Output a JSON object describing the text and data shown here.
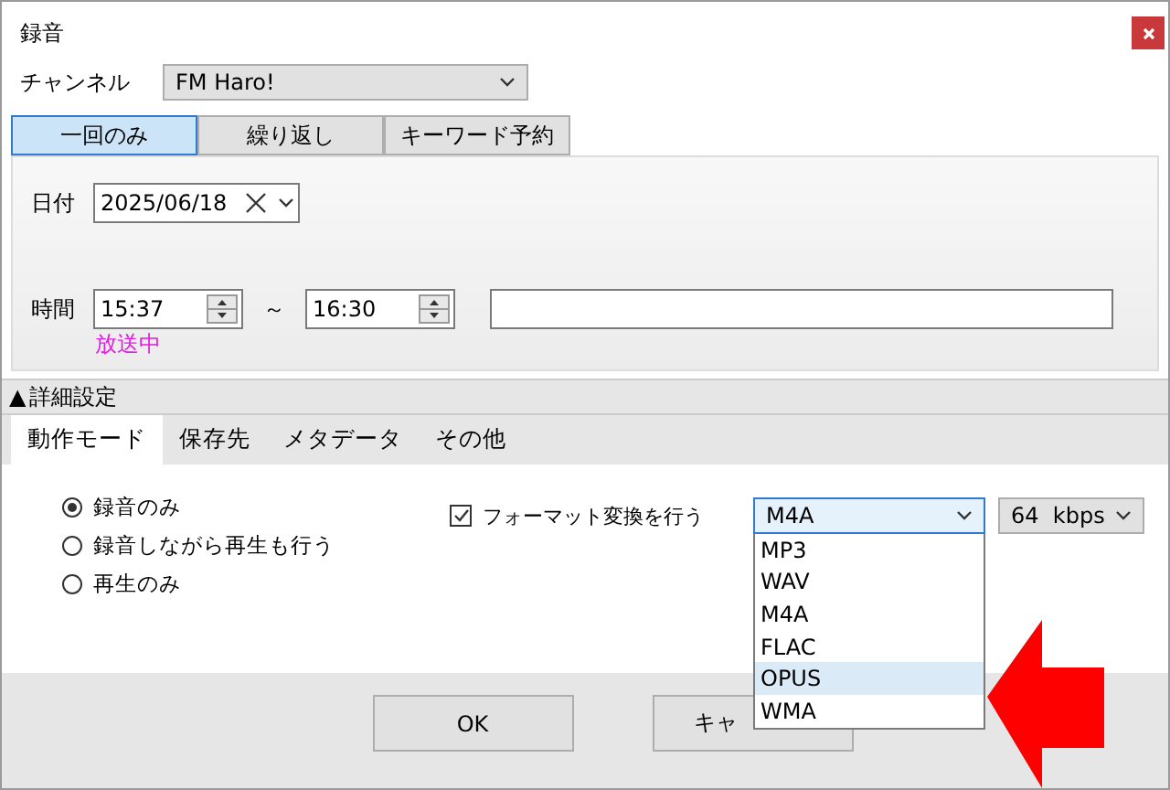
{
  "window": {
    "title": "録音"
  },
  "channel": {
    "label": "チャンネル",
    "value": "FM Haro!"
  },
  "schedule_tabs": [
    {
      "label": "一回のみ",
      "selected": true
    },
    {
      "label": "繰り返し",
      "selected": false
    },
    {
      "label": "キーワード予約",
      "selected": false
    }
  ],
  "date": {
    "label": "日付",
    "value": "2025/06/18"
  },
  "time": {
    "label": "時間",
    "start": "15:37",
    "separator": "～",
    "end": "16:30",
    "status": "放送中"
  },
  "details": {
    "toggle": "▲",
    "label": "詳細設定"
  },
  "settings_tabs": [
    {
      "label": "動作モード",
      "selected": true
    },
    {
      "label": "保存先",
      "selected": false
    },
    {
      "label": "メタデータ",
      "selected": false
    },
    {
      "label": "その他",
      "selected": false
    }
  ],
  "modes": [
    {
      "label": "録音のみ",
      "selected": true
    },
    {
      "label": "録音しながら再生も行う",
      "selected": false
    },
    {
      "label": "再生のみ",
      "selected": false
    }
  ],
  "format_conversion": {
    "label": "フォーマット変換を行う",
    "checked": true
  },
  "format": {
    "value": "M4A",
    "open": true,
    "options": [
      {
        "label": "MP3",
        "highlighted": false
      },
      {
        "label": "WAV",
        "highlighted": false
      },
      {
        "label": "M4A",
        "highlighted": false
      },
      {
        "label": "FLAC",
        "highlighted": false
      },
      {
        "label": "OPUS",
        "highlighted": true
      },
      {
        "label": "WMA",
        "highlighted": false
      }
    ]
  },
  "bitrate": {
    "value": "64  kbps"
  },
  "buttons": [
    {
      "label": "OK"
    },
    {
      "label": "キャ"
    }
  ]
}
